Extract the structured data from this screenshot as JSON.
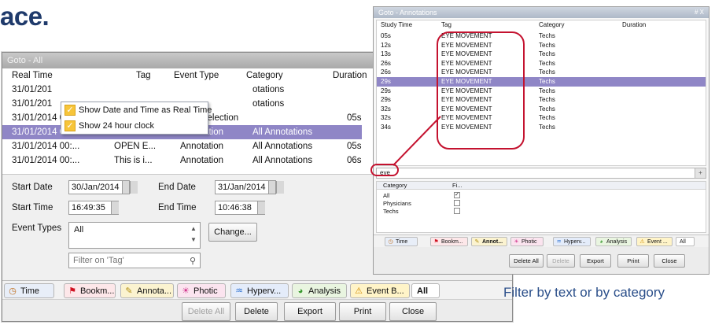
{
  "heading": "ace.",
  "caption": "Filter by text or by category",
  "window1": {
    "title": "Goto - All",
    "columns": [
      "Real Time",
      "Tag",
      "Event Type",
      "Category",
      "Duration"
    ],
    "rows": [
      {
        "time": "31/01/201",
        "tag": "",
        "type": "",
        "category": "otations",
        "duration": ""
      },
      {
        "time": "31/01/201",
        "tag": "",
        "type": "",
        "category": "otations",
        "duration": ""
      },
      {
        "time": "31/01/2014 00:...",
        "tag": "",
        "type": "Kept Selection",
        "category": "",
        "duration": "05s"
      },
      {
        "time": "31/01/2014 00:...",
        "tag": "?",
        "type": "Annotation",
        "category": "All Annotations",
        "duration": ""
      },
      {
        "time": "31/01/2014 00:...",
        "tag": "OPEN E...",
        "type": "Annotation",
        "category": "All Annotations",
        "duration": "05s"
      },
      {
        "time": "31/01/2014 00:...",
        "tag": "This is i...",
        "type": "Annotation",
        "category": "All Annotations",
        "duration": "06s"
      }
    ],
    "context_menu": [
      "Show Date and Time as Real Time",
      "Show 24 hour clock"
    ],
    "form": {
      "start_date_label": "Start Date",
      "start_date": "30/Jan/2014",
      "end_date_label": "End Date",
      "end_date": "31/Jan/2014",
      "start_time_label": "Start Time",
      "start_time": "16:49:35",
      "end_time_label": "End Time",
      "end_time": "10:46:38",
      "event_types_label": "Event Types",
      "event_types_value": "All",
      "change_button": "Change...",
      "filter_placeholder": "Filter on 'Tag'"
    },
    "tabs": [
      {
        "label": "Time",
        "icon": "clock-icon"
      },
      {
        "label": "Bookm...",
        "icon": "bookmark-icon"
      },
      {
        "label": "Annota...",
        "icon": "annotation-icon"
      },
      {
        "label": "Photic",
        "icon": "photic-icon"
      },
      {
        "label": "Hyperv...",
        "icon": "hyperventilation-icon"
      },
      {
        "label": "Analysis",
        "icon": "analysis-icon"
      },
      {
        "label": "Event B...",
        "icon": "warning-icon"
      },
      {
        "label": "All",
        "icon": ""
      }
    ],
    "buttons": [
      "Delete All",
      "Delete",
      "Export",
      "Print",
      "Close"
    ]
  },
  "window2": {
    "title": "Goto - Annotations",
    "title_controls": "# X",
    "columns": [
      "Study Time",
      "Tag",
      "Category",
      "Duration"
    ],
    "rows": [
      {
        "time": "05s",
        "tag": "EYE MOVEMENT",
        "category": "Techs"
      },
      {
        "time": "12s",
        "tag": "EYE MOVEMENT",
        "category": "Techs"
      },
      {
        "time": "13s",
        "tag": "EYE MOVEMENT",
        "category": "Techs"
      },
      {
        "time": "26s",
        "tag": "EYE MOVEMENT",
        "category": "Techs"
      },
      {
        "time": "26s",
        "tag": "EYE MOVEMENT",
        "category": "Techs"
      },
      {
        "time": "29s",
        "tag": "EYE MOVEMENT",
        "category": "Techs"
      },
      {
        "time": "29s",
        "tag": "EYE MOVEMENT",
        "category": "Techs"
      },
      {
        "time": "29s",
        "tag": "EYE MOVEMENT",
        "category": "Techs"
      },
      {
        "time": "32s",
        "tag": "EYE MOVEMENT",
        "category": "Techs"
      },
      {
        "time": "32s",
        "tag": "EYE MOVEMENT",
        "category": "Techs"
      },
      {
        "time": "34s",
        "tag": "EYE MOVEMENT",
        "category": "Techs"
      }
    ],
    "search_value": "eye",
    "category_header": [
      "Category",
      "Fi..."
    ],
    "categories": [
      {
        "name": "All",
        "checked": true
      },
      {
        "name": "Physicians",
        "checked": false
      },
      {
        "name": "Techs",
        "checked": false
      }
    ],
    "tabs": [
      "Time",
      "Bookm...",
      "Annot...",
      "Photic",
      "Hyperv...",
      "Analysis",
      "Event ...",
      "All"
    ],
    "buttons": [
      "Delete All",
      "Delete",
      "Export",
      "Print",
      "Close"
    ]
  },
  "colors": {
    "selection": "#8f86c6",
    "highlight_ring": "#c4122f",
    "heading": "#1f3a6b"
  }
}
